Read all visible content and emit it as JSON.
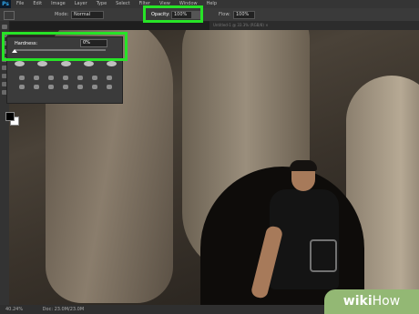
{
  "app": {
    "logo": "Ps"
  },
  "menu": [
    "File",
    "Edit",
    "Image",
    "Layer",
    "Type",
    "Select",
    "Filter",
    "View",
    "Window",
    "Help"
  ],
  "options": {
    "mode_label": "Mode:",
    "mode_value": "Normal",
    "opacity_label": "Opacity:",
    "opacity_value": "100%",
    "flow_label": "Flow:",
    "flow_value": "100%"
  },
  "doc_tab": "Untitled-1 @ 33.3% (RGB/8) ×",
  "brush_panel": {
    "title": "Hardness:",
    "value": "0%",
    "level_percent": 0
  },
  "status": {
    "zoom": "40.24%",
    "doc": "Doc: 23.0M/23.0M"
  },
  "watermark": {
    "wiki": "wiki",
    "how": "How"
  },
  "colors": {
    "highlight": "#27e327",
    "fg_swatch": "#000000",
    "bg_swatch": "#ffffff"
  }
}
